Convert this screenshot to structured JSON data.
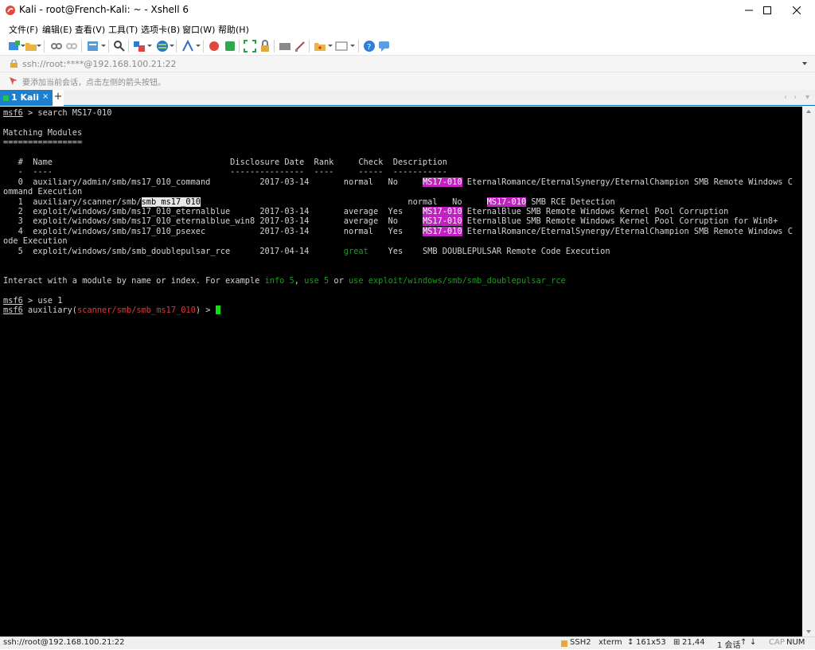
{
  "window": {
    "title": "Kali - root@French-Kali: ~ - Xshell 6"
  },
  "menu": [
    "文件(F)",
    "编辑(E)",
    "查看(V)",
    "工具(T)",
    "选项卡(B)",
    "窗口(W)",
    "帮助(H)"
  ],
  "address": {
    "value": "ssh://root:****@192.168.100.21:22"
  },
  "hint": {
    "text": "要添加当前会话，点击左侧的箭头按钮。"
  },
  "tabs": [
    {
      "label": "1 Kali",
      "close": "×"
    }
  ],
  "tabbar": {
    "add": "+",
    "prev": "‹",
    "next": "›",
    "menu": "▾"
  },
  "terminal": {
    "prompt": "msf6",
    "cmd_search": " > search MS17-010",
    "matching": "Matching Modules",
    "underline": "================",
    "headers": "   #  Name                                    Disclosure Date  Rank     Check  Description",
    "header_rule": "   -  ----                                    ---------------  ----     -----  -----------",
    "rows": [
      {
        "pre": "   0  auxiliary/admin/smb/ms17_010_command          2017-03-14       normal   No     ",
        "hl": "MS17-010",
        "post": " EternalRomance/EternalSynergy/EternalChampion SMB Remote Windows C"
      },
      {
        "pre": "ommand Execution",
        "hl": "",
        "post": ""
      },
      {
        "pre": "   1  auxiliary/scanner/smb/",
        "sel": "smb_ms17_010",
        "mid": "                                          normal   No     ",
        "hl": "MS17-010",
        "post": " SMB RCE Detection"
      },
      {
        "pre": "   2  exploit/windows/smb/ms17_010_eternalblue      2017-03-14       average  Yes    ",
        "hl": "MS17-010",
        "post": " EternalBlue SMB Remote Windows Kernel Pool Corruption"
      },
      {
        "pre": "   3  exploit/windows/smb/ms17_010_eternalblue_win8 2017-03-14       average  No     ",
        "hl": "MS17-010",
        "post": " EternalBlue SMB Remote Windows Kernel Pool Corruption for Win8+"
      },
      {
        "pre": "   4  exploit/windows/smb/ms17_010_psexec           2017-03-14       normal   Yes    ",
        "hl": "MS17-010",
        "post": " EternalRomance/EternalSynergy/EternalChampion SMB Remote Windows C"
      },
      {
        "pre": "ode Execution",
        "hl": "",
        "post": ""
      },
      {
        "pre": "   5  exploit/windows/smb/smb_doublepulsar_rce      2017-04-14       ",
        "green": "great",
        "post": "    Yes    SMB DOUBLEPULSAR Remote Code Execution"
      }
    ],
    "interact_pre": "Interact with a module by name or index. For example ",
    "interact_g1": "info 5",
    "interact_c1": ", ",
    "interact_g2": "use 5",
    "interact_c2": " or ",
    "interact_g3": "use exploit/windows/smb/smb_doublepulsar_rce",
    "cmd_use": " > use 1",
    "module_prefix": " auxiliary(",
    "module_name": "scanner/smb/smb_ms17_010",
    "module_suffix": ") > "
  },
  "status": {
    "connection": "ssh://root@192.168.100.21:22",
    "protocol": "SSH2",
    "term": "xterm",
    "size": "161x53",
    "pos": "21,44",
    "sessions": "1 会话",
    "cap": "CAP",
    "num": "NUM"
  },
  "colors": {
    "titlebar": "#ffffff",
    "tab_active": "#1d7fd0",
    "terminal_bg": "#000000",
    "highlight": "#c022c0",
    "green": "#1e9a1e",
    "red": "#d83b3b"
  }
}
